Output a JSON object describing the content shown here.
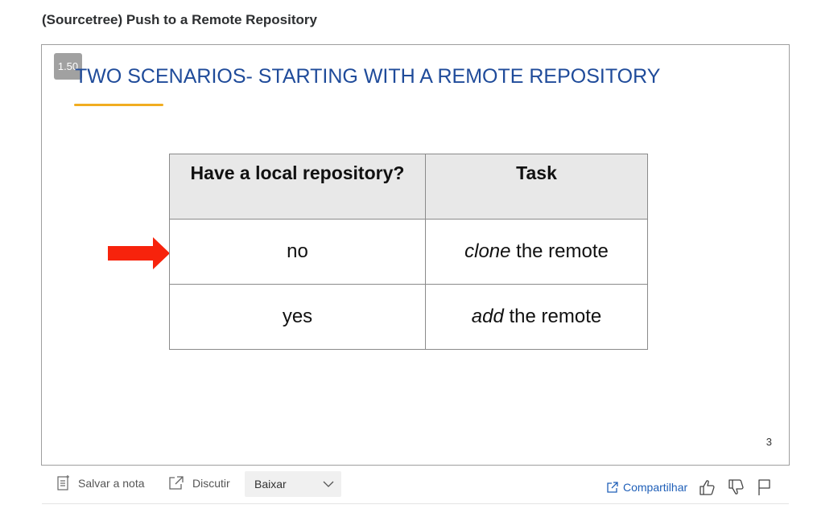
{
  "page": {
    "title": "(Sourcetree) Push to a Remote Repository"
  },
  "slide": {
    "speed": "1.50",
    "heading": "TWO SCENARIOS- STARTING WITH A REMOTE REPOSITORY",
    "slide_number": "3",
    "table": {
      "headers": [
        "Have a local repository?",
        "Task"
      ],
      "rows": [
        {
          "local": "no",
          "task_verb": "clone",
          "task_rest": " the remote"
        },
        {
          "local": "yes",
          "task_verb": "add",
          "task_rest": " the remote"
        }
      ]
    },
    "colors": {
      "heading": "#1f4b9a",
      "underline": "#f1ad21",
      "arrow": "#f7230c"
    }
  },
  "toolbar": {
    "save_note_label": "Salvar a nota",
    "discuss_label": "Discutir",
    "download_label": "Baixar",
    "share_label": "Compartilhar",
    "icons": [
      "note-icon",
      "external-link-icon",
      "chevron-down-icon",
      "share-icon",
      "thumbs-up-icon",
      "thumbs-down-icon",
      "flag-icon"
    ]
  }
}
